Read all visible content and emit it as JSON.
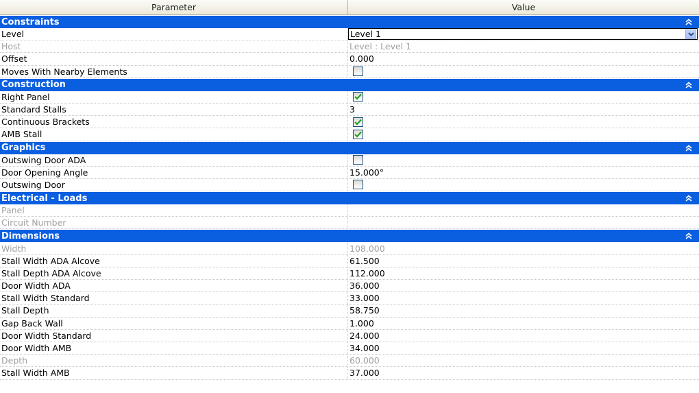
{
  "header": {
    "parameter": "Parameter",
    "value": "Value"
  },
  "groups": [
    {
      "title": "Constraints",
      "rows": [
        {
          "param": "Level",
          "value": "Level 1",
          "type": "combo"
        },
        {
          "param": "Host",
          "value": "Level : Level 1",
          "disabled": true
        },
        {
          "param": "Offset",
          "value": "0.000"
        },
        {
          "param": "Moves With Nearby Elements",
          "type": "checkbox",
          "checked": false
        }
      ]
    },
    {
      "title": "Construction",
      "rows": [
        {
          "param": "Right Panel",
          "type": "checkbox",
          "checked": true
        },
        {
          "param": "Standard Stalls",
          "value": "3"
        },
        {
          "param": "Continuous Brackets",
          "type": "checkbox",
          "checked": true
        },
        {
          "param": "AMB Stall",
          "type": "checkbox",
          "checked": true
        }
      ]
    },
    {
      "title": "Graphics",
      "rows": [
        {
          "param": "Outswing Door ADA",
          "type": "checkbox",
          "checked": false
        },
        {
          "param": "Door Opening Angle",
          "value": "15.000°"
        },
        {
          "param": "Outswing Door",
          "type": "checkbox",
          "checked": false
        }
      ]
    },
    {
      "title": "Electrical - Loads",
      "rows": [
        {
          "param": "Panel",
          "value": "",
          "disabled": true
        },
        {
          "param": "Circuit Number",
          "value": "",
          "disabled": true
        }
      ]
    },
    {
      "title": "Dimensions",
      "rows": [
        {
          "param": "Width",
          "value": "108.000",
          "disabled": true
        },
        {
          "param": "Stall Width ADA Alcove",
          "value": "61.500"
        },
        {
          "param": "Stall Depth ADA Alcove",
          "value": "112.000"
        },
        {
          "param": "Door Width ADA",
          "value": "36.000"
        },
        {
          "param": "Stall Width Standard",
          "value": "33.000"
        },
        {
          "param": "Stall Depth",
          "value": "58.750"
        },
        {
          "param": "Gap Back Wall",
          "value": "1.000"
        },
        {
          "param": "Door Width Standard",
          "value": "24.000"
        },
        {
          "param": "Door Width AMB",
          "value": "34.000"
        },
        {
          "param": "Depth",
          "value": "60.000",
          "disabled": true
        },
        {
          "param": "Stall Width AMB",
          "value": "37.000"
        }
      ]
    }
  ],
  "colors": {
    "group_bg": "#0a5ee0",
    "check": "#21a121",
    "disabled_text": "#a0a0a0"
  }
}
